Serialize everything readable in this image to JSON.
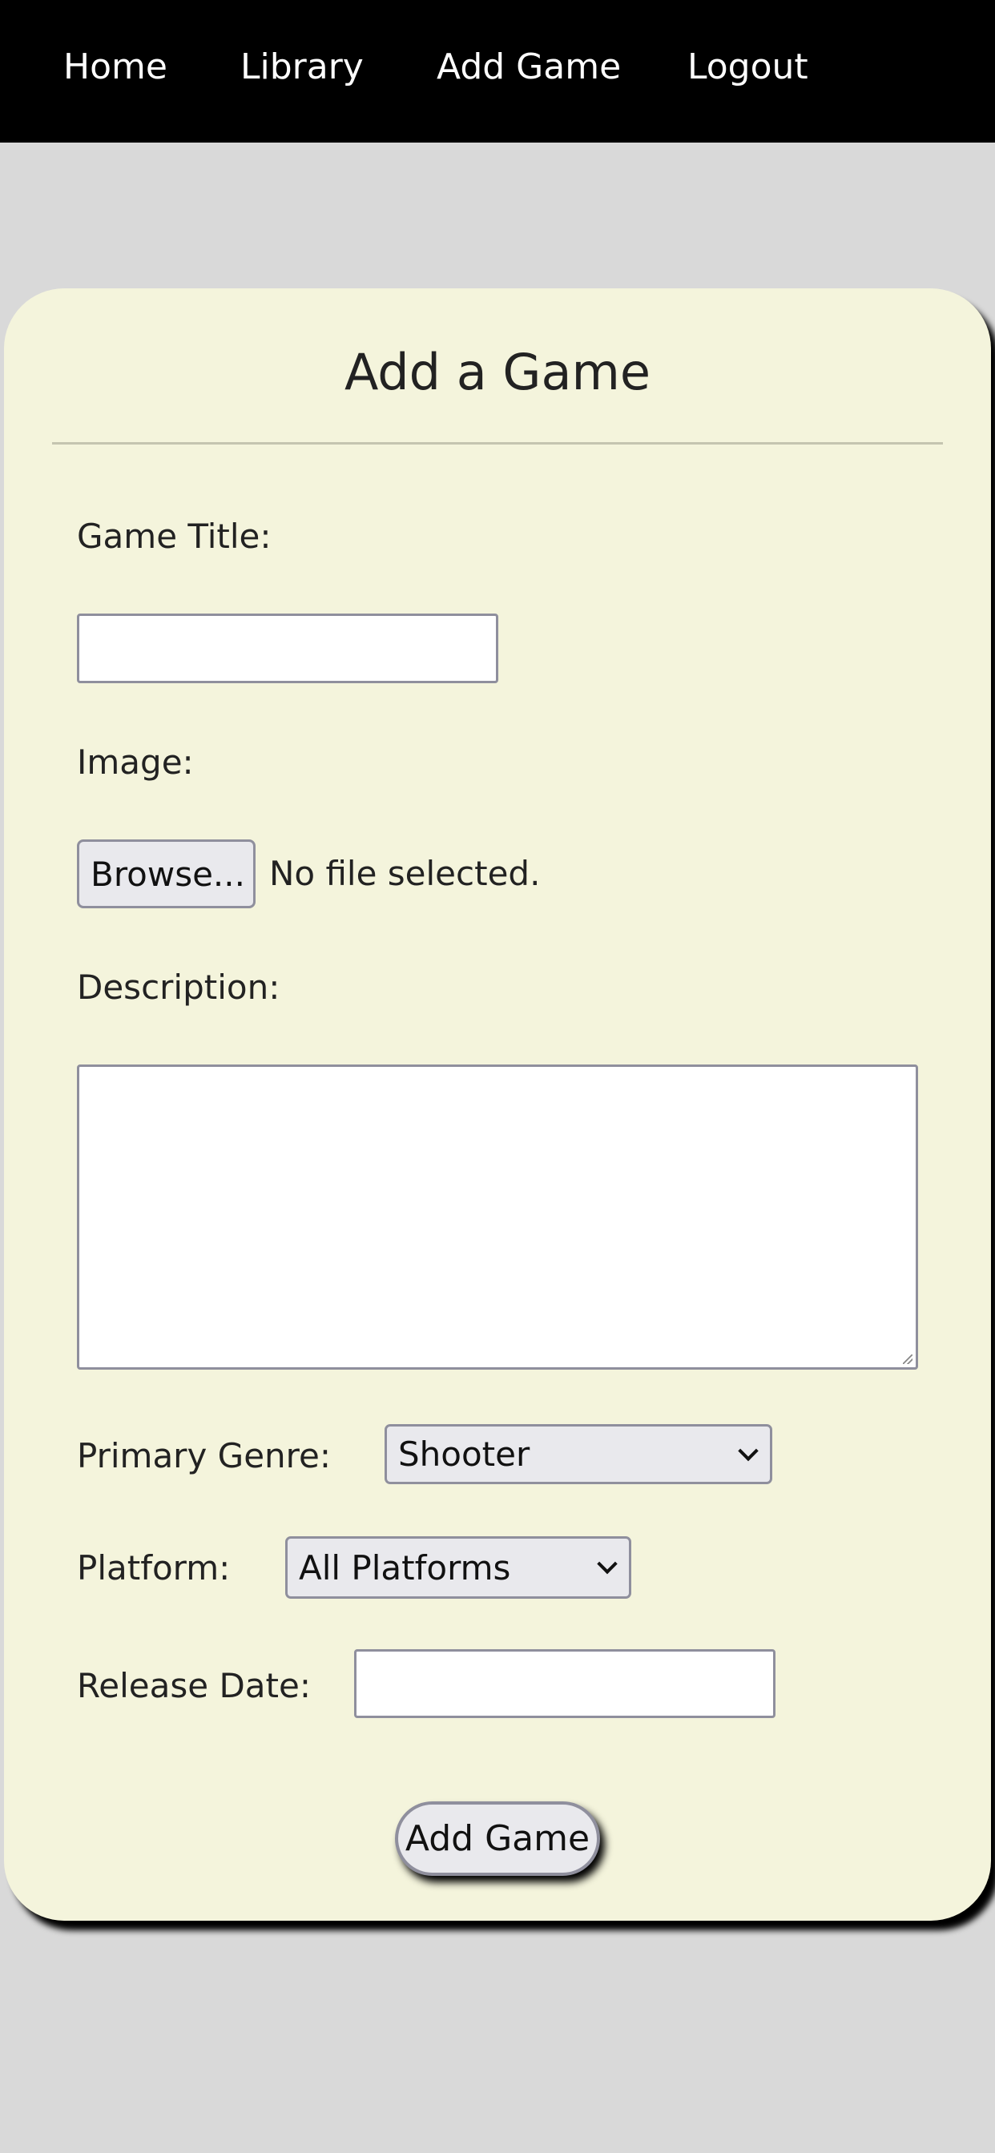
{
  "nav": {
    "items": [
      {
        "label": "Home"
      },
      {
        "label": "Library"
      },
      {
        "label": "Add Game"
      },
      {
        "label": "Logout"
      }
    ]
  },
  "form": {
    "title": "Add a Game",
    "game_title_label": "Game Title:",
    "game_title_value": "",
    "image_label": "Image:",
    "browse_label": "Browse...",
    "no_file_text": "No file selected.",
    "description_label": "Description:",
    "description_value": "",
    "genre_label": "Primary Genre:",
    "genre_selected": "Shooter",
    "platform_label": "Platform:",
    "platform_selected": "All Platforms",
    "release_date_label": "Release Date:",
    "release_date_value": "",
    "submit_label": "Add Game"
  },
  "colors": {
    "nav_bg": "#000000",
    "page_bg": "#d9d9d9",
    "card_bg": "#f4f4dc"
  }
}
